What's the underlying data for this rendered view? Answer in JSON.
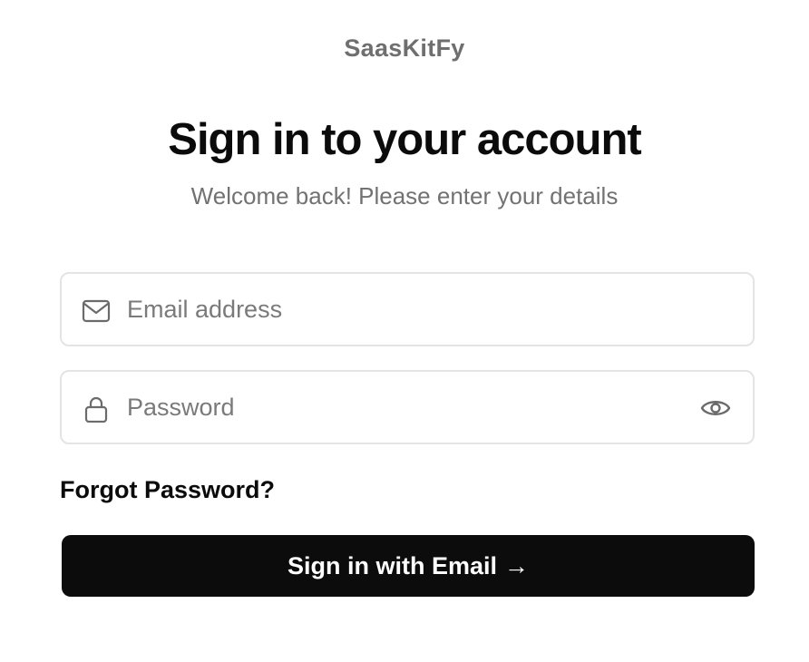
{
  "brand": {
    "name": "SaasKitFy"
  },
  "header": {
    "title": "Sign in to your account",
    "subtitle": "Welcome back! Please enter your details"
  },
  "form": {
    "email": {
      "placeholder": "Email address",
      "value": "",
      "icon": "mail-icon"
    },
    "password": {
      "placeholder": "Password",
      "value": "",
      "icon": "lock-icon",
      "toggle_icon": "eye-icon"
    },
    "forgot_label": "Forgot Password?",
    "submit_label": "Sign in with Email",
    "submit_arrow": "→"
  },
  "colors": {
    "background": "#ffffff",
    "text_primary": "#0b0b0b",
    "text_muted": "#727272",
    "border": "#e4e4e4",
    "button_bg": "#0c0c0c",
    "button_text": "#ffffff"
  }
}
